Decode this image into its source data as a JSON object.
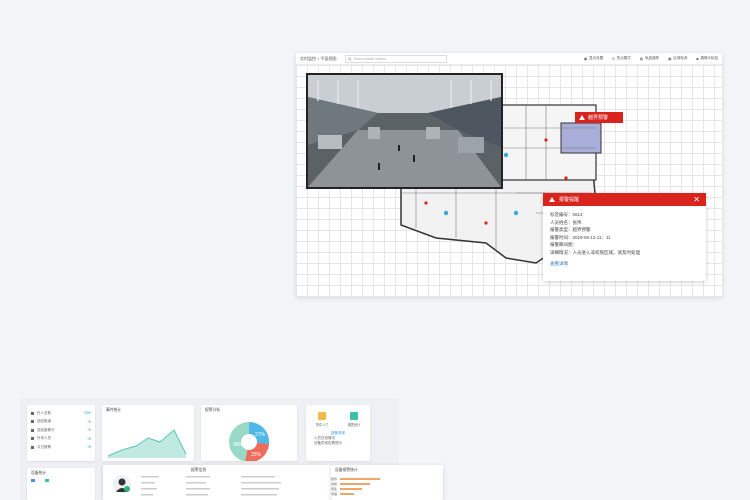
{
  "main_window": {
    "breadcrumb": "实时监控 > 平面视图",
    "search_placeholder": "Search detail objects",
    "toolbar": [
      {
        "label": "显示设置",
        "icon": "display-icon"
      },
      {
        "label": "热点模式",
        "icon": "location-icon"
      },
      {
        "label": "轨迹追踪",
        "icon": "track-icon"
      },
      {
        "label": "区域轮询",
        "icon": "area-icon"
      },
      {
        "label": "摄像头轮巡",
        "icon": "camera-icon"
      }
    ]
  },
  "alarm_tag": {
    "label": "越界预警"
  },
  "alarm_popup": {
    "title": "报警提醒",
    "fields": [
      "标签编号：0613",
      "人员姓名：张伟",
      "报警类型：越界预警",
      "报警时间：2019-06-13 11：11",
      "报警瞬间图：",
      "详细情况：人员进入非权限区域，请及时处理"
    ],
    "link": "查看详情"
  },
  "dashboard": {
    "stats": [
      {
        "label": "在人总数",
        "value": "7360"
      },
      {
        "label": "巡回取道",
        "value": "76"
      },
      {
        "label": "巡检摄像头",
        "value": "76"
      },
      {
        "label": "外来人员",
        "value": "76"
      },
      {
        "label": "今日报警",
        "value": "76"
      }
    ],
    "trend_title": "事件统计",
    "pie_title": "报警分析",
    "pie_labels": [
      "27%",
      "48%",
      "25%"
    ],
    "pie_colors": [
      "#4fb8e8",
      "#9ad9c8",
      "#ef6b5a"
    ],
    "quick": {
      "a": "事件入门",
      "b": "报表统计"
    },
    "note_title": "报警简报",
    "notes": [
      "人员在岗情况",
      "设备异常告警提示"
    ],
    "device_title": "设备统计",
    "person_title": "报警信息",
    "rank_title": "设备报警统计",
    "ranks": [
      "越界",
      "滞留",
      "聚集",
      "徘徊",
      "其他"
    ]
  }
}
